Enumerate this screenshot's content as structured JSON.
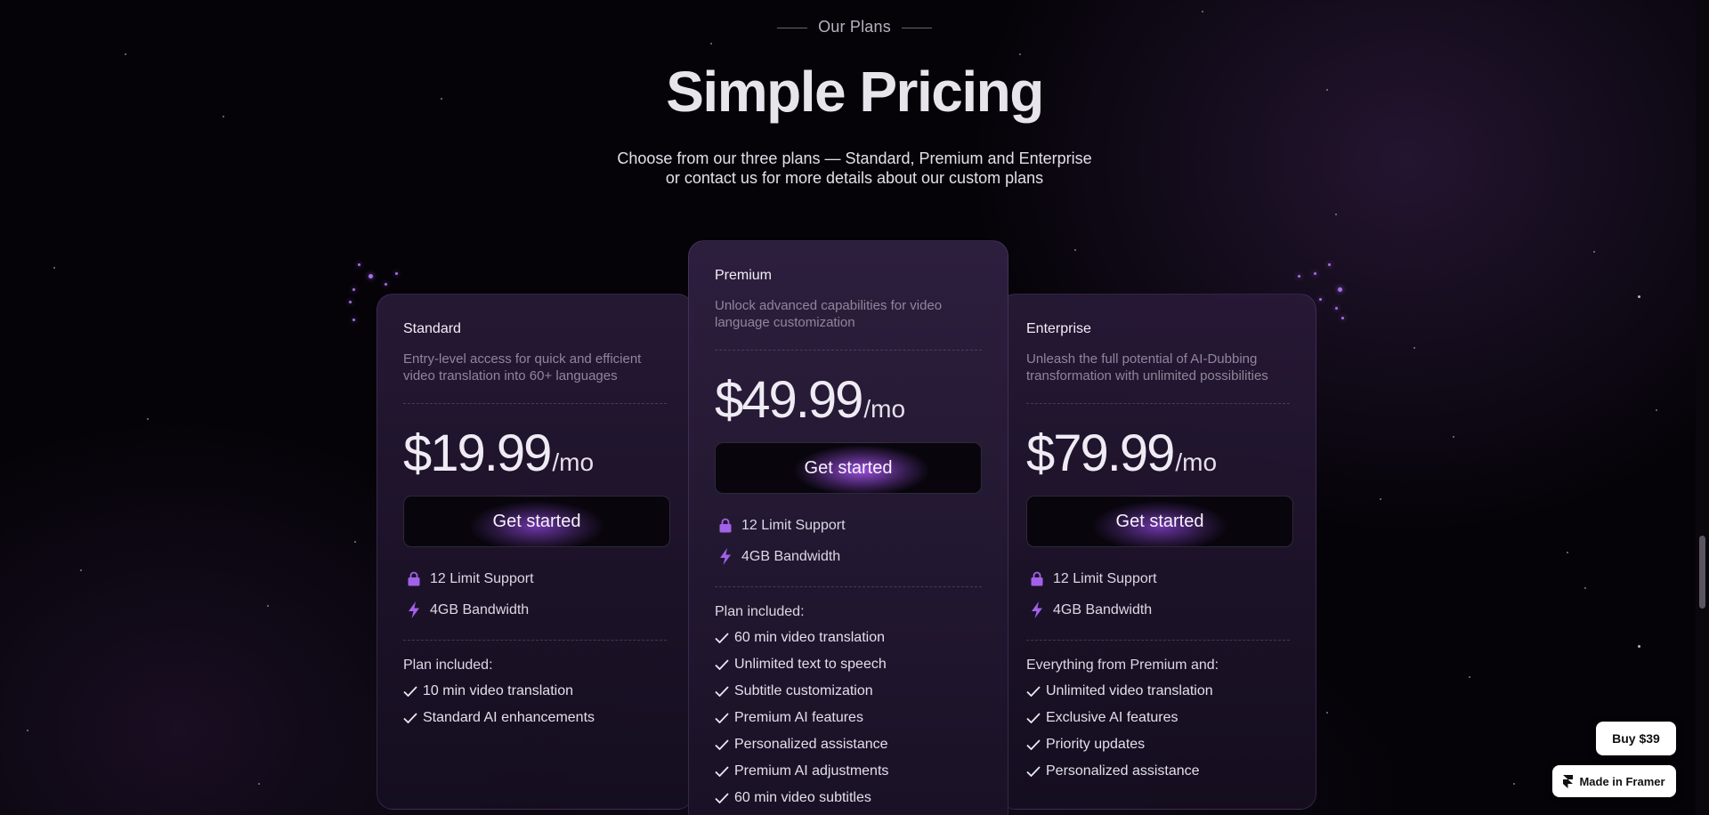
{
  "header": {
    "eyebrow": "Our Plans",
    "title": "Simple Pricing",
    "subtitle_line1": "Choose from our three plans — Standard, Premium and Enterprise",
    "subtitle_line2": "or contact us for more details about our custom plans"
  },
  "plans": [
    {
      "name": "Standard",
      "desc_line1": "Entry-level access for quick and efficient",
      "desc_line2": "video translation into 60+ languages",
      "price": "$19.99",
      "per": "/mo",
      "cta": "Get started",
      "resources": [
        "12 Limit Support",
        "4GB Bandwidth"
      ],
      "included_title": "Plan included:",
      "features": [
        "10 min video translation",
        "Standard AI enhancements"
      ]
    },
    {
      "name": "Premium",
      "desc_line1": "Unlock advanced capabilities for video",
      "desc_line2": "language customization",
      "price": "$49.99",
      "per": "/mo",
      "cta": "Get started",
      "resources": [
        "12 Limit Support",
        "4GB Bandwidth"
      ],
      "included_title": "Plan included:",
      "features": [
        "60 min video translation",
        "Unlimited text to speech",
        "Subtitle customization",
        "Premium AI features",
        "Personalized assistance",
        "Premium AI adjustments",
        "60 min video subtitles"
      ]
    },
    {
      "name": "Enterprise",
      "desc_line1": "Unleash the full potential of AI-Dubbing",
      "desc_line2": "transformation with unlimited possibilities",
      "price": "$79.99",
      "per": "/mo",
      "cta": "Get started",
      "resources": [
        "12 Limit Support",
        "4GB Bandwidth"
      ],
      "included_title": "Everything from Premium and:",
      "features": [
        "Unlimited video translation",
        "Exclusive AI features",
        "Priority updates",
        "Personalized assistance"
      ]
    }
  ],
  "icons": {
    "resource_0": "lock-icon",
    "resource_1": "lightning-bolt-icon",
    "feature": "checkmark-icon",
    "framer": "framer-logo-icon"
  },
  "floating": {
    "buy_label": "Buy $39",
    "framer_label": "Made in Framer"
  },
  "colors": {
    "accent": "#a162e8",
    "background": "#050308",
    "card": "#221630"
  }
}
